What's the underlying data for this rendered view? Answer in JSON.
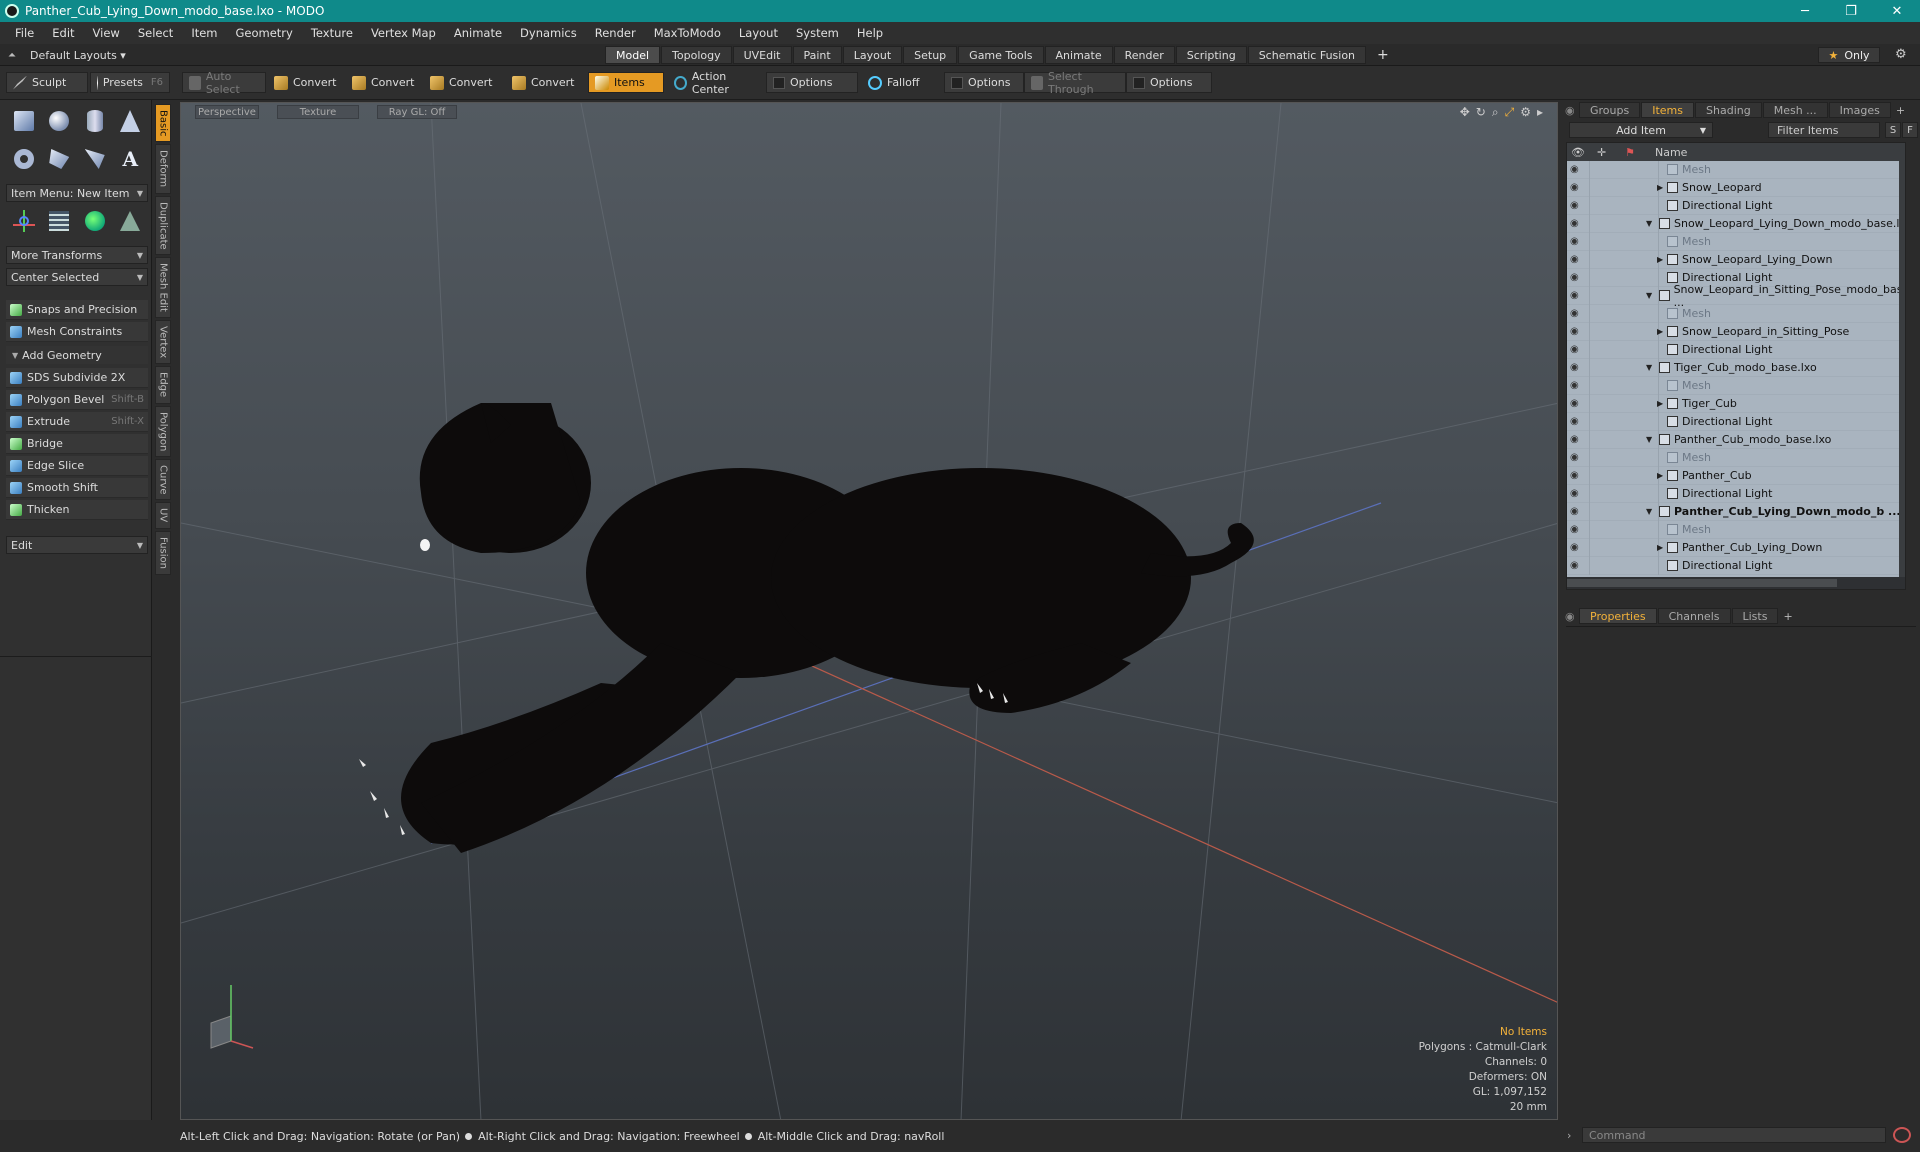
{
  "window": {
    "title": "Panther_Cub_Lying_Down_modo_base.lxo - MODO",
    "min": "─",
    "restore": "❐",
    "close": "✕"
  },
  "menu": [
    "File",
    "Edit",
    "View",
    "Select",
    "Item",
    "Geometry",
    "Texture",
    "Vertex Map",
    "Animate",
    "Dynamics",
    "Render",
    "MaxToModo",
    "Layout",
    "System",
    "Help"
  ],
  "layout": {
    "default_layouts": "Default Layouts ▾",
    "tabs": [
      "Model",
      "Topology",
      "UVEdit",
      "Paint",
      "Layout",
      "Setup",
      "Game Tools",
      "Animate",
      "Render",
      "Scripting",
      "Schematic Fusion"
    ],
    "plus": "+",
    "only": "Only"
  },
  "toolbar": {
    "sculpt": "Sculpt",
    "presets": "Presets",
    "presets_key": "F6",
    "auto_select": "Auto Select",
    "convert": "Convert",
    "items": "Items",
    "action_center": "Action Center",
    "options": "Options",
    "falloff": "Falloff",
    "select_through": "Select Through"
  },
  "left": {
    "item_menu": "Item Menu: New Item",
    "more_transforms": "More Transforms",
    "center_selected": "Center Selected",
    "snaps": "Snaps and Precision",
    "mesh_constraints": "Mesh Constraints",
    "add_geometry": "Add Geometry",
    "tools": [
      {
        "label": "SDS Subdivide 2X",
        "key": ""
      },
      {
        "label": "Polygon Bevel",
        "key": "Shift-B"
      },
      {
        "label": "Extrude",
        "key": "Shift-X"
      },
      {
        "label": "Bridge",
        "key": ""
      },
      {
        "label": "Edge Slice",
        "key": ""
      },
      {
        "label": "Smooth Shift",
        "key": ""
      },
      {
        "label": "Thicken",
        "key": ""
      }
    ],
    "edit": "Edit",
    "vtabs": [
      "Basic",
      "Deform",
      "Duplicate",
      "Mesh Edit",
      "Vertex",
      "Edge",
      "Polygon",
      "Curve",
      "UV",
      "Fusion"
    ]
  },
  "viewport": {
    "perspective": "Perspective",
    "texture": "Texture",
    "raygl": "Ray GL: Off",
    "stats": {
      "no_items": "No Items",
      "polygons": "Polygons : Catmull-Clark",
      "channels": "Channels: 0",
      "deformers": "Deformers: ON",
      "gl": "GL: 1,097,152",
      "scale": "20 mm"
    }
  },
  "right": {
    "tabs": [
      "Groups",
      "Items",
      "Shading",
      "Mesh ...",
      "Images"
    ],
    "add_item": "Add Item",
    "filter_items": "Filter Items",
    "s": "S",
    "f": "F",
    "name_col": "Name",
    "rows": [
      {
        "label": "Mesh",
        "level": 2,
        "type": "mesh",
        "tri": ""
      },
      {
        "label": "Snow_Leopard",
        "level": 2,
        "type": "item",
        "tri": "▶"
      },
      {
        "label": "Directional Light",
        "level": 2,
        "type": "light",
        "tri": ""
      },
      {
        "label": "Snow_Leopard_Lying_Down_modo_base.lxo",
        "level": 1,
        "type": "scene",
        "tri": "▼"
      },
      {
        "label": "Mesh",
        "level": 2,
        "type": "mesh",
        "tri": ""
      },
      {
        "label": "Snow_Leopard_Lying_Down",
        "level": 2,
        "type": "item",
        "tri": "▶"
      },
      {
        "label": "Directional Light",
        "level": 2,
        "type": "light",
        "tri": ""
      },
      {
        "label": "Snow_Leopard_in_Sitting_Pose_modo_bas ...",
        "level": 1,
        "type": "scene",
        "tri": "▼"
      },
      {
        "label": "Mesh",
        "level": 2,
        "type": "mesh",
        "tri": ""
      },
      {
        "label": "Snow_Leopard_in_Sitting_Pose",
        "level": 2,
        "type": "item",
        "tri": "▶"
      },
      {
        "label": "Directional Light",
        "level": 2,
        "type": "light",
        "tri": ""
      },
      {
        "label": "Tiger_Cub_modo_base.lxo",
        "level": 1,
        "type": "scene",
        "tri": "▼"
      },
      {
        "label": "Mesh",
        "level": 2,
        "type": "mesh",
        "tri": ""
      },
      {
        "label": "Tiger_Cub",
        "level": 2,
        "type": "item",
        "tri": "▶"
      },
      {
        "label": "Directional Light",
        "level": 2,
        "type": "light",
        "tri": ""
      },
      {
        "label": "Panther_Cub_modo_base.lxo",
        "level": 1,
        "type": "scene",
        "tri": "▼"
      },
      {
        "label": "Mesh",
        "level": 2,
        "type": "mesh",
        "tri": ""
      },
      {
        "label": "Panther_Cub",
        "level": 2,
        "type": "item",
        "tri": "▶"
      },
      {
        "label": "Directional Light",
        "level": 2,
        "type": "light",
        "tri": ""
      },
      {
        "label": "Panther_Cub_Lying_Down_modo_b ...",
        "level": 1,
        "type": "scene",
        "tri": "▼",
        "bold": true
      },
      {
        "label": "Mesh",
        "level": 2,
        "type": "mesh",
        "tri": ""
      },
      {
        "label": "Panther_Cub_Lying_Down",
        "level": 2,
        "type": "item",
        "tri": "▶"
      },
      {
        "label": "Directional Light",
        "level": 2,
        "type": "light",
        "tri": ""
      }
    ],
    "ptabs": [
      "Properties",
      "Channels",
      "Lists"
    ]
  },
  "status": {
    "hint1": "Alt-Left Click and Drag: Navigation: Rotate (or Pan)",
    "hint2": "Alt-Right Click and Drag: Navigation: Freewheel",
    "hint3": "Alt-Middle Click and Drag: navRoll",
    "command": "Command"
  },
  "colors": {
    "accent": "#e59a23",
    "title_bar": "#0f8a8a",
    "panther": "#0d0b0b",
    "tree_bg": "#a9b4bf"
  }
}
